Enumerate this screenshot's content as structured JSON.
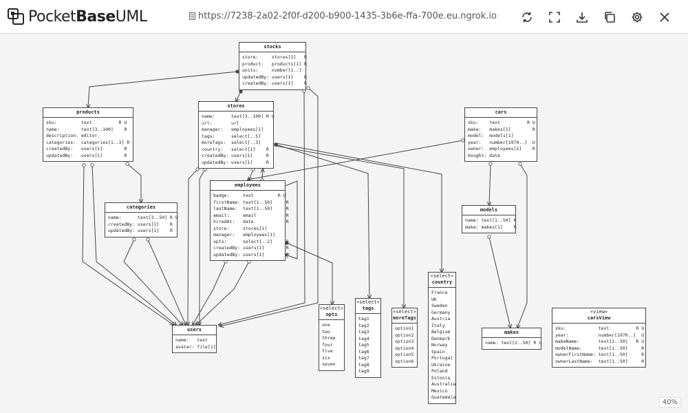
{
  "app": {
    "brand_regular": "Pocket",
    "brand_bold": "Base",
    "brand_suffix": "UML"
  },
  "url": "https://7238-2a02-2f0f-d200-b900-1435-3b6e-ffa-700e.eu.ngrok.io",
  "zoom": "40%",
  "tables": {
    "stocks": {
      "title": "stocks",
      "body": "store:     stores[1]   R\nproduct:   products[1] R\nunits:     number[1..]\nupdatedBy: users[1]    R\ncreatedBy: users[1]    R"
    },
    "products": {
      "title": "products",
      "body": "sku:         text          R U\nname:        text[3..100]    R\ndescription: editor\ncategories:  categories[1..3] R\ncreatedBy:   users[1]        R\nupdatedBy:   users[1]        R"
    },
    "stores": {
      "title": "stores",
      "body": "name:      text[3..100] R U\nurl:       url\nmanager:   employees[1]\ntags:      select[..5]\nmoreTags:  select[..3]\ncountry:   select[1]    R\ncreatedBy: users[1]     R\nupdatedBy: users[1]     R"
    },
    "cars": {
      "title": "cars",
      "body": "sku:    text          R U\nmake:   makes[1]        R\nmodel:  models[1]\nyear:   number[1970..]  U\nowner:  employees[1]    R\nbought: date"
    },
    "categories": {
      "title": "categories",
      "body": "name:      text[3..50] R U\ncreatedBy: users[1]    R\nupdatedBy: users[1]    R"
    },
    "employees": {
      "title": "employees",
      "body": "badge:     text         R U\nfirstName: text[1..50]     R\nlastName:  text[1..50]     R\nemail:     email           R\nhiredAt:   date            R\nstore:     stores[1]\nmanager:   employees[1]\nopts:      select[..2]     R\ncreatedBy: users[1]        R\nupdatedBy: users[1]        R"
    },
    "models": {
      "title": "models",
      "body": "name: text[1..50] R\nmake: makes[1]    R"
    },
    "users": {
      "title": "users",
      "body": "name:   text\navatar: file[1]"
    },
    "opts": {
      "stereo": "«select»",
      "title": "opts",
      "body": "one\ntwo\nthree\nfour\nfive\nsix\nseven"
    },
    "tags": {
      "stereo": "«select»",
      "title": "tags",
      "body": "tag1\ntag2\ntag3\ntag4\ntag5\ntag6\ntag7\ntag8\ntag9"
    },
    "moreTags": {
      "stereo": "«select»",
      "title": "moreTags",
      "body": "option1\noption2\noption3\noption4\noption5\noption6"
    },
    "country": {
      "stereo": "«select»",
      "title": "country",
      "body": "France\nUK\nSweden\nGermany\nAustria\nItaly\nBelgium\nDenmark\nNorway\nSpain\nPortugal\nUkraine\nPoland\nEstonia\nAustralia\nMexico\nGuatemala"
    },
    "makes": {
      "title": "makes",
      "body": "name: text[2..50] R U"
    },
    "carsView": {
      "stereo": "«view»",
      "title": "carsView",
      "body": "sku:            text          R U\nyear:           number[1970..]  U\nmakeName:       text[2..50]   R U\nmodelName:      text[1..50]     R\nownerFirstName: text[1..50]     R\nownerLastName:  text[1..50]     R"
    }
  }
}
